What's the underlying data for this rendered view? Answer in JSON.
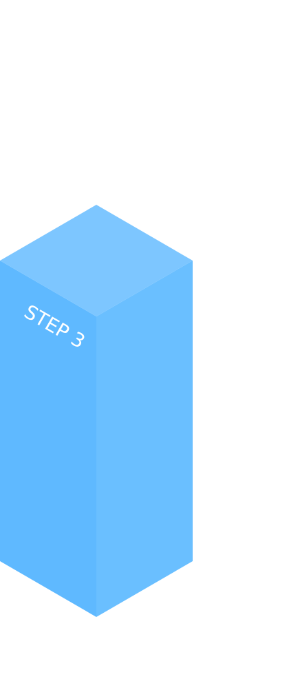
{
  "block": {
    "label": "STEP 3",
    "colors": {
      "top": "#7dc6ff",
      "left": "#5fb9ff",
      "right": "#6abfff",
      "label": "#ffffff"
    }
  }
}
